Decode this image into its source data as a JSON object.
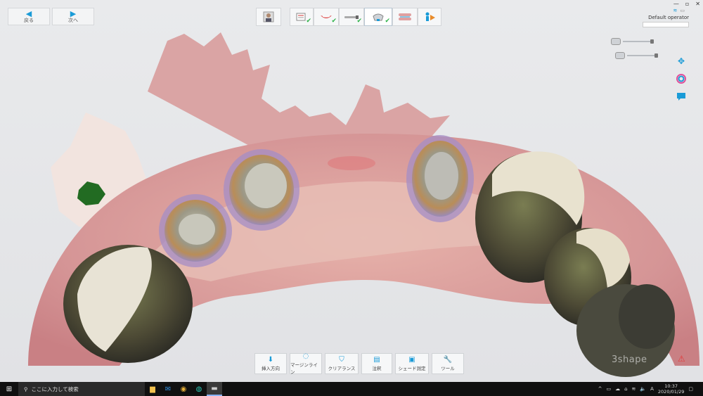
{
  "nav": {
    "back_label": "戻る",
    "forward_label": "次へ"
  },
  "window": {
    "minimize": "—",
    "maximize": "▫",
    "close": "✕"
  },
  "operator": {
    "name": "Default operator"
  },
  "toolbar": {
    "insert_direction": "挿入方向",
    "margin_line": "マージンライン",
    "clearance": "クリアランス",
    "annotation": "注釈",
    "shade": "シェード測定",
    "tools": "ツール"
  },
  "brand": {
    "text": "3shape"
  },
  "taskbar": {
    "search_placeholder": "ここに入力して検索",
    "time": "10:37",
    "date": "2020/01/29"
  },
  "colors": {
    "accent": "#1a9bd7",
    "check": "#2fb24a",
    "warning": "#e13b3b"
  },
  "icons": {
    "back": "arrow-left-icon",
    "forward": "arrow-right-icon",
    "pan": "move-icon",
    "color": "color-wheel-icon",
    "comment": "comment-icon"
  }
}
